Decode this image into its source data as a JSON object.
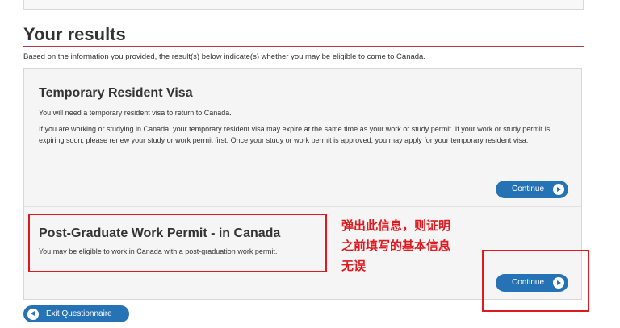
{
  "page": {
    "title": "Your results",
    "intro": "Based on the information you provided, the result(s) below indicate(s) whether you may be eligible to come to Canada."
  },
  "results": [
    {
      "heading": "Temporary Resident Visa",
      "paragraphs": [
        "You will need a temporary resident visa to return to Canada.",
        "If you are working or studying in Canada, your temporary resident visa may expire at the same time as your work or study permit. If your work or study permit is expiring soon, please renew your study or work permit first. Once your study or work permit is approved, you may apply for your temporary resident visa."
      ],
      "button_label": "Continue"
    },
    {
      "heading": "Post-Graduate Work Permit - in Canada",
      "paragraphs": [
        "You may be eligible to work in Canada with a post-graduation work permit."
      ],
      "button_label": "Continue"
    }
  ],
  "exit_button": {
    "label": "Exit Questionnaire"
  },
  "annotation": {
    "lines": [
      "弹出此信息，则证明",
      "之前填写的基本信息",
      "无误"
    ],
    "color": "#e0191f"
  },
  "colors": {
    "button": "#2572b4",
    "title_rule": "#af3c43",
    "card_bg": "#f5f5f5"
  },
  "icons": {
    "continue": "play-circle-icon",
    "exit": "back-circle-icon"
  }
}
